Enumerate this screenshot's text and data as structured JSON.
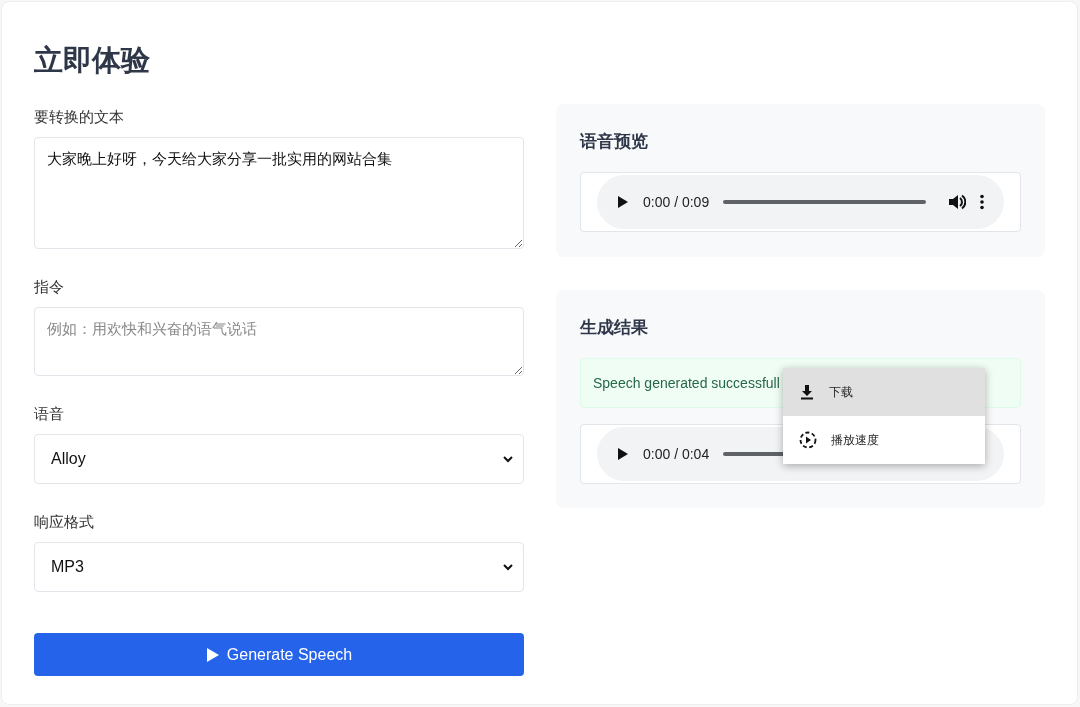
{
  "title": "立即体验",
  "form": {
    "fields": [
      {
        "kind": "textarea",
        "label": "要转换的文本",
        "value": "大家晚上好呀，今天给大家分享一批实用的网站合集"
      },
      {
        "kind": "textarea",
        "label": "指令",
        "placeholder": "例如：用欢快和兴奋的语气说话"
      },
      {
        "kind": "select",
        "label": "语音",
        "value": "Alloy"
      },
      {
        "kind": "select",
        "label": "响应格式",
        "value": "MP3"
      }
    ],
    "submit_button": "Generate Speech"
  },
  "preview": {
    "title": "语音预览",
    "player": {
      "time": "0:00 / 0:09"
    }
  },
  "result": {
    "title": "生成结果",
    "message": "Speech generated successfull",
    "player": {
      "time": "0:00 / 0:04"
    },
    "menu": [
      {
        "label": "下载",
        "kind": "download",
        "selected": true
      },
      {
        "label": "播放速度",
        "kind": "speed",
        "selected": false
      }
    ]
  }
}
